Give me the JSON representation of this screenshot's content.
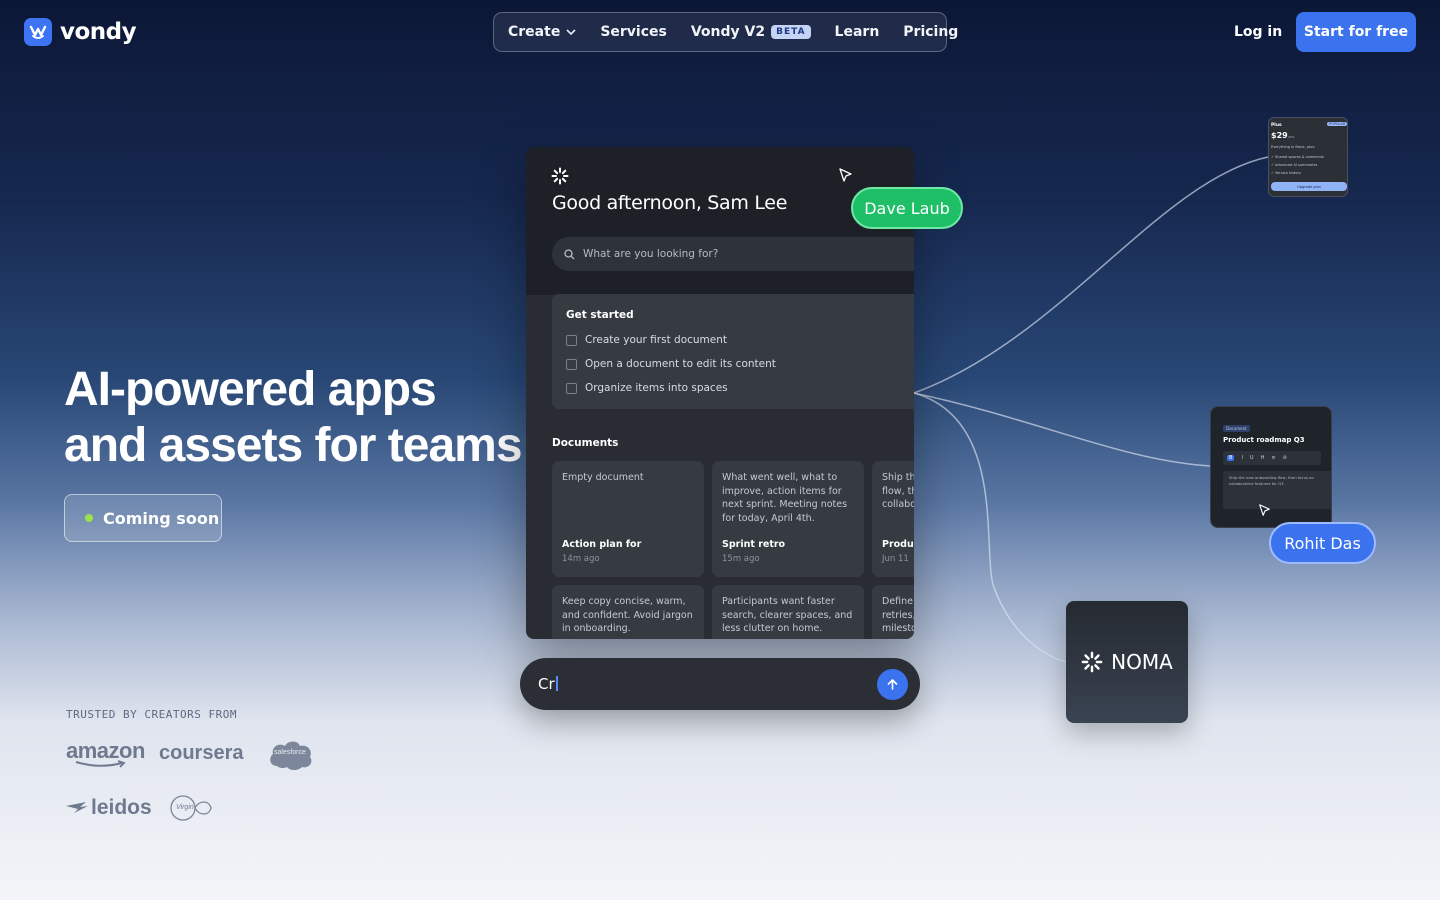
{
  "nav": {
    "logo_text": "vondy",
    "items": [
      {
        "label": "Create",
        "has_dropdown": true
      },
      {
        "label": "Services"
      },
      {
        "label": "Vondy V2",
        "badge": "BETA"
      },
      {
        "label": "Learn"
      },
      {
        "label": "Pricing"
      }
    ],
    "login_label": "Log in",
    "cta_label": "Start for free"
  },
  "hero": {
    "title_line1": "AI-powered apps",
    "title_line2": "and assets for teams",
    "status_label": "Coming soon",
    "status_color": "#9be34a"
  },
  "trusted": {
    "label": "TRUSTED BY CREATORS FROM",
    "brands": [
      "amazon",
      "coursera",
      "salesforce",
      "leidos",
      "Virgin"
    ]
  },
  "app": {
    "greeting": "Good afternoon, Sam Lee",
    "search_placeholder": "What are you looking for?",
    "get_started": {
      "title": "Get started",
      "items": [
        "Create your first document",
        "Open a document to edit its content",
        "Organize items into spaces"
      ]
    },
    "documents_title": "Documents",
    "cards": [
      {
        "text": "Empty document",
        "title": "Action plan for",
        "time": "14m ago"
      },
      {
        "text": "What went well, what to improve, action items for next sprint. Meeting notes for today, April 4th.",
        "title": "Sprint retro",
        "time": "15m ago"
      },
      {
        "text": "Ship th flow, th collabo",
        "title": "Produc",
        "time": "Jun 11"
      },
      {
        "text": "Keep copy concise, warm, and confident. Avoid jargon in onboarding."
      },
      {
        "text": "Participants want faster search, clearer spaces, and less clutter on home."
      },
      {
        "text": "Define retries, milesto"
      }
    ]
  },
  "prompt": {
    "value": "Cr"
  },
  "collaborators": [
    "Dave Laub",
    "Rohit Das"
  ],
  "mini_price": {
    "plan": "Plus",
    "price": "$29",
    "period": "/mo",
    "badge": "POPULAR",
    "tagline": "Everything in Basic, plus:",
    "features": [
      "Shared spaces & comments",
      "Advanced AI summaries",
      "Version history"
    ],
    "button": "Upgrade plan"
  },
  "mini_doc": {
    "badge": "Document",
    "title": "Product roadmap Q3",
    "toolbar": [
      "B",
      "I",
      "U",
      "H",
      "≡",
      "⊘"
    ],
    "body": "Ship the new onboarding flow, then focus on collaborative features for Q3."
  },
  "noma": {
    "label": "NOMA"
  },
  "colors": {
    "accent": "#3b73ef",
    "green_tag": "#1fbf68"
  }
}
